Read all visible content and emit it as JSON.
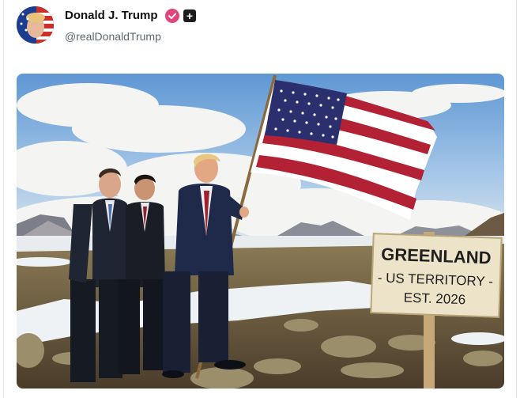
{
  "post": {
    "display_name": "Donald J. Trump",
    "handle": "@realDonaldTrump",
    "verified_icon": "verified-badge-icon",
    "follow_icon": "plus-icon",
    "follow_label": "+"
  },
  "image": {
    "sign_line1": "GREENLAND",
    "sign_line2": "- US TERRITORY -",
    "sign_line3": "EST. 2026"
  },
  "colors": {
    "verified": "#e0457b",
    "sky": "#6fa8dc",
    "flag_red": "#b22234",
    "flag_blue": "#2c2f6e"
  }
}
